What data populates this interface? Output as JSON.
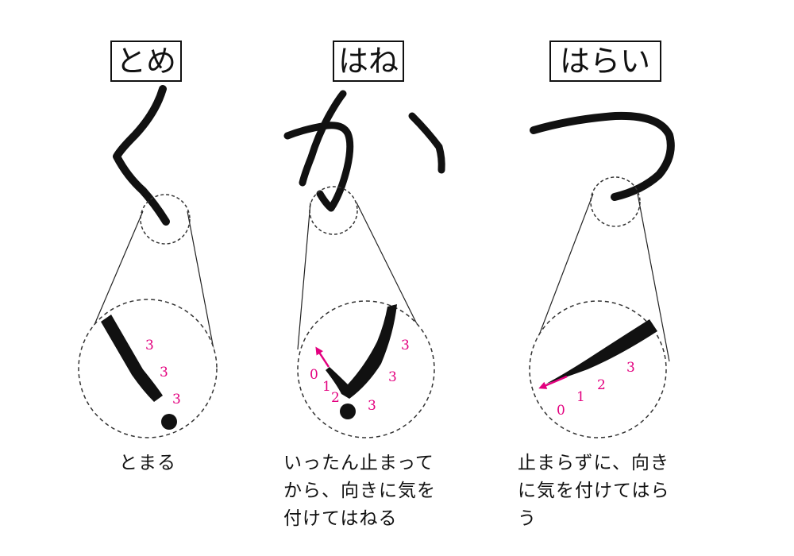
{
  "colors": {
    "ink": "#111111",
    "accent": "#e3007f",
    "line": "#333333"
  },
  "panels": [
    {
      "title": "とめ",
      "kana": "く",
      "numbers": [
        "3",
        "3",
        "3"
      ],
      "caption_lines": [
        "とまる"
      ]
    },
    {
      "title": "はね",
      "kana": "か",
      "numbers": [
        "0",
        "1",
        "2",
        "3",
        "3",
        "3"
      ],
      "caption_lines": [
        "いったん止まって",
        "から、向きに気を",
        "付けてはねる"
      ]
    },
    {
      "title": "はらい",
      "kana": "つ",
      "numbers": [
        "0",
        "1",
        "2",
        "3"
      ],
      "caption_lines": [
        "止まらずに、向き",
        "に気を付けてはら",
        "う"
      ]
    }
  ]
}
